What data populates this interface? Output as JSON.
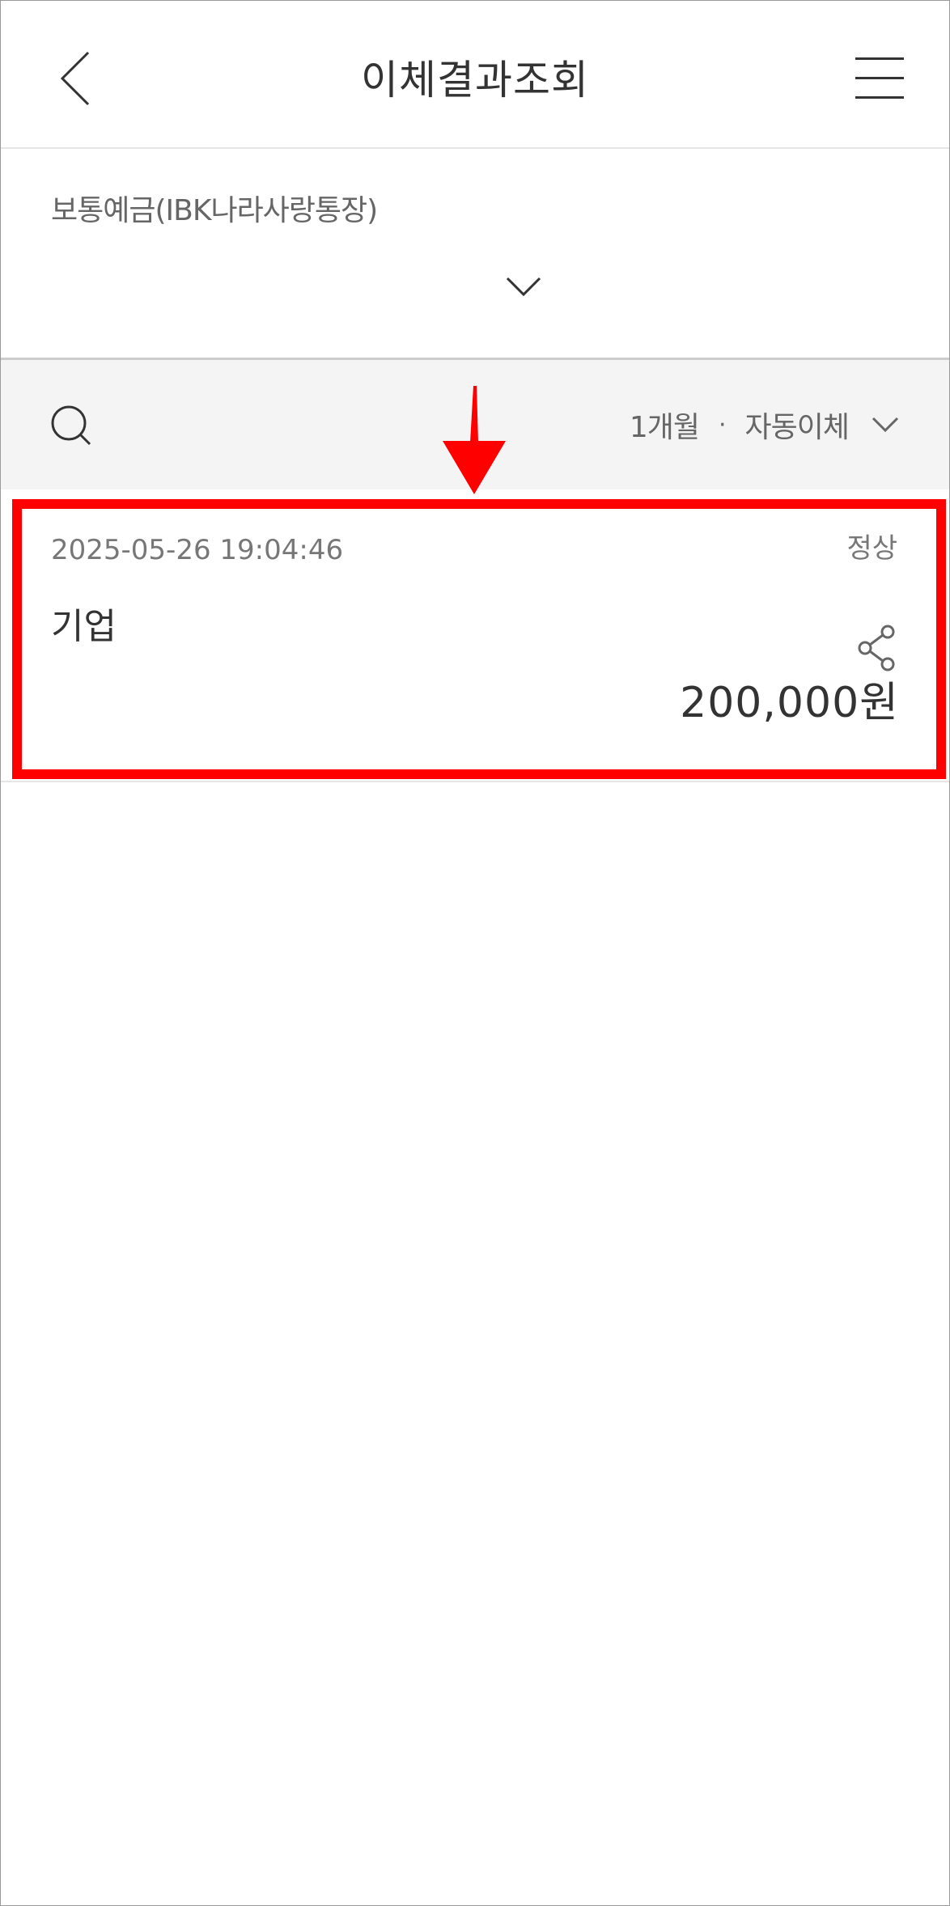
{
  "header": {
    "title": "이체결과조회",
    "back_icon": "chevron-left-icon",
    "menu_icon": "hamburger-menu-icon"
  },
  "account": {
    "name": "보통예금(IBK나라사랑통장)",
    "expand_icon": "chevron-down-icon"
  },
  "filter": {
    "period": "1개월",
    "separator": "·",
    "type": "자동이체",
    "search_icon": "search-icon",
    "dropdown_icon": "chevron-down-icon"
  },
  "transactions": [
    {
      "datetime": "2025-05-26 19:04:46",
      "status": "정상",
      "bank": "기업",
      "amount": "200,000원",
      "share_icon": "share-icon"
    }
  ],
  "colors": {
    "highlight": "#ff0000",
    "filter_bg": "#f4f4f4",
    "text_primary": "#333333",
    "text_secondary": "#777777"
  }
}
